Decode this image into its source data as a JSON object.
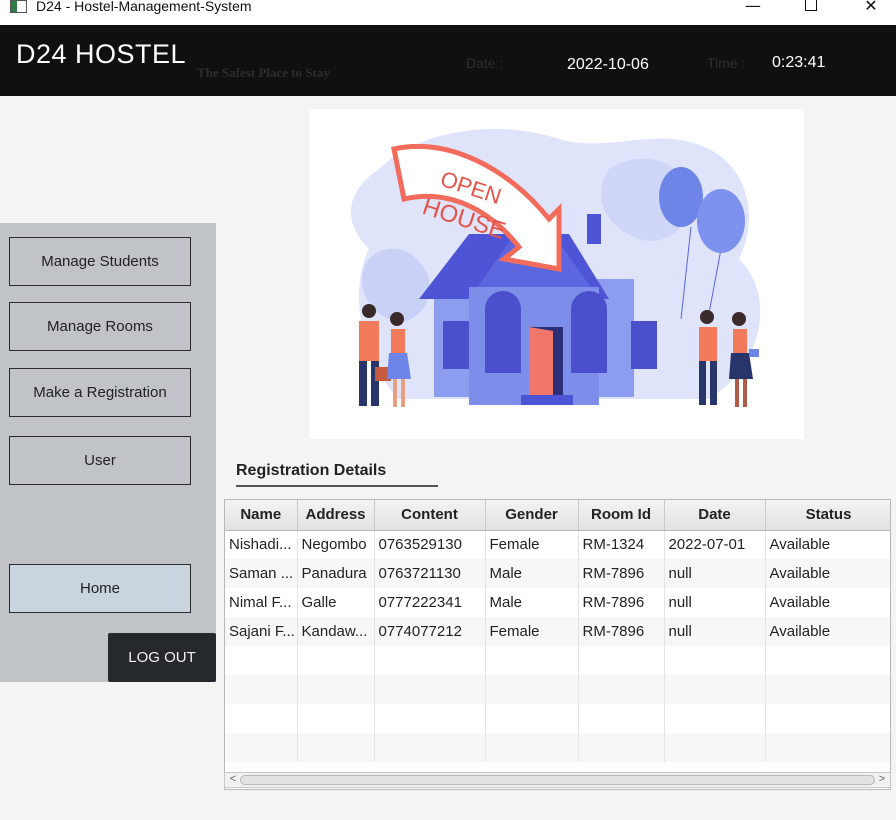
{
  "window": {
    "title": "D24 - Hostel-Management-System",
    "controls": {
      "minimize": "—",
      "close": "✕"
    }
  },
  "header": {
    "brand": "D24 HOSTEL",
    "tagline": "The Safest Place to Stay",
    "date_label": "Date :",
    "date_value": "2022-10-06",
    "time_label": "Time :",
    "time_value": "0:23:41"
  },
  "sidebar": {
    "items": [
      {
        "label": "Manage Students"
      },
      {
        "label": "Manage Rooms"
      },
      {
        "label": "Make a  Registration"
      },
      {
        "label": "User"
      },
      {
        "label": "Home"
      }
    ],
    "logout": "LOG OUT"
  },
  "illustration": {
    "banner_line1": "OPEN",
    "banner_line2": "HOUSE"
  },
  "registration": {
    "title": "Registration Details",
    "columns": [
      "Name",
      "Address",
      "Content",
      "Gender",
      "Room Id",
      "Date",
      "Status"
    ],
    "rows": [
      [
        "Nishadi...",
        "Negombo",
        "0763529130",
        "Female",
        "RM-1324",
        "2022-07-01",
        "Available"
      ],
      [
        "Saman ...",
        "Panadura",
        "0763721130",
        "Male",
        "RM-7896",
        "null",
        "Available"
      ],
      [
        "Nimal F...",
        "Galle",
        "0777222341",
        "Male",
        "RM-7896",
        "null",
        "Available"
      ],
      [
        "Sajani F...",
        "Kandaw...",
        "0774077212",
        "Female",
        "RM-7896",
        "null",
        "Available"
      ]
    ]
  },
  "scrollbar": {
    "left": "<",
    "right": ">"
  }
}
